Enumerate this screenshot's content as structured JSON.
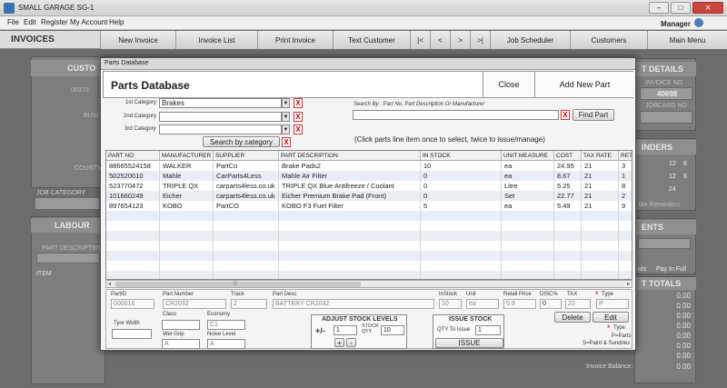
{
  "window": {
    "title": "SMALL GARAGE SG-1",
    "min": "–",
    "max": "□",
    "close": "✕"
  },
  "menu": {
    "items": [
      "File",
      "Edit",
      "Register",
      "My Account",
      "Help"
    ],
    "user": "Manager"
  },
  "toolbar": {
    "title": "INVOICES",
    "buttons": [
      "New Invoice",
      "Invoice List",
      "Print Invoice",
      "Text Customer",
      "|<",
      "<",
      ">",
      ">|",
      "Job Scheduler",
      "Customers",
      "Main Menu"
    ]
  },
  "background": {
    "customer_header": "CUSTO",
    "code": "00370",
    "busi": "BUSI",
    "county": "COUNTY",
    "job_category": "JOB CATEGORY",
    "labour": "LABOUR",
    "part_description": "PART DESCRIPTION",
    "item": "ITEM",
    "details_header": "T DETAILS",
    "invoice_no_label": "INVOICE NO",
    "invoice_no": "40698",
    "jobcard_no_label": "JOBCARD NO",
    "reminders_header": "INDERS",
    "reminder_nums": [
      "12",
      "6",
      "12",
      "6",
      "24"
    ],
    "reminders_text": "ble Reminders",
    "payments_header": "ENTS",
    "nts": "nts",
    "pay_in_full": "Pay In Full",
    "totals_header": "T TOTALS",
    "totals": [
      "0.00",
      "0.00",
      "0.00",
      "0.00",
      "0.00",
      "0.00",
      "0.00",
      "0.00",
      "0.00"
    ],
    "invoice_balance_label": "Invoice Balance:",
    "invoice_balance": "0.00"
  },
  "dialog": {
    "window_title": "Parts Database",
    "title": "Parts Database",
    "close_label": "Close",
    "add_label": "Add New Part",
    "cat1_label": "1st Category",
    "cat1_value": "Brakes",
    "cat2_label": "2nd Category",
    "cat2_value": "",
    "cat3_label": "3rd Category",
    "cat3_value": "",
    "search_cat_label": "Search by category",
    "search_by_label": "Search By : Part No, Part Description Or Manufacturer",
    "search_value": "",
    "find_part_label": "Find Part",
    "hint": "(Click parts line item once to select, twice to issue/manage)",
    "x": "X"
  },
  "table": {
    "columns": [
      "PART NO",
      "MANUFACTURER",
      "SUPPLIER",
      "PART DESCRIPTION",
      "IN STOCK",
      "UNIT MEASURE",
      "COST",
      "TAX RATE",
      "RETA"
    ],
    "rows": [
      [
        "88665524158",
        "WALKER",
        "PartCo",
        "Brake Pads2",
        "10",
        "ea",
        "24.95",
        "21",
        "3"
      ],
      [
        "502520010",
        "Mahle",
        "CarParts4Less",
        "Mahle Air Filter",
        "0",
        "ea",
        "8.67",
        "21",
        "1"
      ],
      [
        "523770472",
        "TRIPLE QX",
        "carparts4less.co.uk",
        "TRIPLE QX Blue Antifreeze / Coolant",
        "0",
        "Litre",
        "5.25",
        "21",
        "8"
      ],
      [
        "101660249",
        "Eicher",
        "carparts4less.co.uk",
        "Eicher Premium Brake Pad (Front)",
        "0",
        "Set",
        "22.77",
        "21",
        "2"
      ],
      [
        "897654123",
        "KOBO",
        "PartCO",
        "KOBO F3 Fuel Filter",
        "5",
        "ea",
        "5.49",
        "21",
        "9"
      ]
    ],
    "scroll_left": "◂",
    "scroll_right": "▸",
    "scroll_grip": "|||"
  },
  "detail": {
    "partid_label": "PartID",
    "partid": "000016",
    "partnum_label": "Part Number",
    "partnum": "CR2032",
    "track_label": "Track",
    "track": "2",
    "partdesc_label": "Part Desc",
    "partdesc": "BATTERY CR2032",
    "instock_label": "InStock",
    "instock": "10",
    "unit_label": "Unit",
    "unit": "ea",
    "retail_label": "Retail Price",
    "retail": "5.9",
    "disc_label": "DISC%",
    "disc": "0",
    "tax_label": "TAX",
    "tax": "20",
    "type_label": "Type",
    "type": "P",
    "star": "*",
    "delete_label": "Delete",
    "edit_label": "Edit",
    "tyre_width_label": "Tyre Width",
    "class_label": "Class",
    "economy_label": "Economy",
    "economy": "C1",
    "wet_grip_label": "Wet Grip",
    "wet_grip": "A",
    "noise_label": "Noise Level",
    "noise": "A",
    "adjust_title": "ADJUST STOCK LEVELS",
    "plus_minus": "+/-",
    "adjust_value": "1",
    "stock_qty_label": "STOCK QTY",
    "stock_qty": "10",
    "plus": "+",
    "minus": "-",
    "issue_title": "ISSUE STOCK",
    "qty_issue_label": "QTY To Issue",
    "qty_issue": "1",
    "issue_btn": "ISSUE",
    "type_legend_title": "Type",
    "type_legend_p": "P=Parts",
    "type_legend_s": "S=Paint & Sundries"
  }
}
